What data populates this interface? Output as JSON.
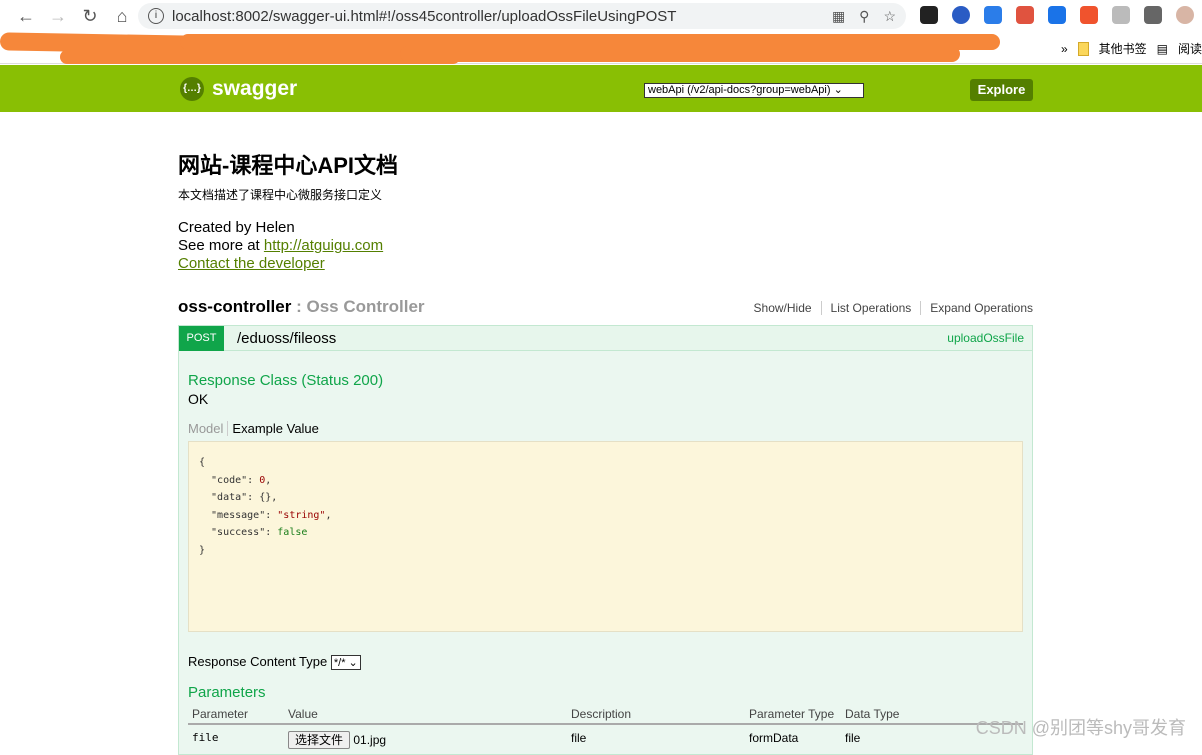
{
  "browser": {
    "url": "localhost:8002/swagger-ui.html#!/oss45controller/uploadOssFileUsingPOST",
    "bookmarks": [
      "其他书签",
      "阅读"
    ]
  },
  "header": {
    "logo": "swagger",
    "api_select": "webApi (/v2/api-docs?group=webApi)",
    "explore": "Explore",
    "brand_color": "#89bf04"
  },
  "info": {
    "title": "网站-课程中心API文档",
    "description": "本文档描述了课程中心微服务接口定义",
    "created_by": "Created by Helen",
    "see_more_prefix": "See more at ",
    "see_more_link": "http://atguigu.com",
    "contact": "Contact the developer"
  },
  "resource": {
    "name": "oss-controller",
    "sep": " : ",
    "desc": "Oss Controller",
    "ops": [
      "Show/Hide",
      "List Operations",
      "Expand Operations"
    ]
  },
  "operation": {
    "method": "POST",
    "path": "/eduoss/fileoss",
    "nickname": "uploadOssFile",
    "method_color": "#10a54a",
    "response_class": "Response Class (Status 200)",
    "response_msg": "OK",
    "tab_model": "Model",
    "tab_example": "Example Value",
    "example": {
      "code": "0",
      "data": "{}",
      "message": "\"string\"",
      "success": "false"
    },
    "response_content_type_label": "Response Content Type",
    "response_content_type": "*/*",
    "parameters_title": "Parameters",
    "param_headers": [
      "Parameter",
      "Value",
      "Description",
      "Parameter Type",
      "Data Type"
    ],
    "params": [
      {
        "name": "file",
        "button": "选择文件",
        "file": "01.jpg",
        "description": "file",
        "param_type": "formData",
        "data_type": "file"
      }
    ]
  },
  "watermark": "CSDN @别团等shy哥发育"
}
